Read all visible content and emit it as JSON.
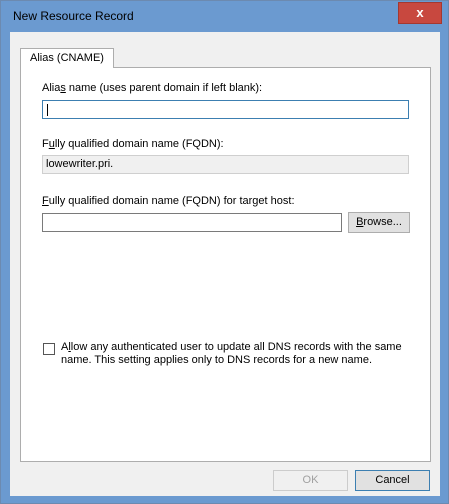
{
  "window": {
    "title": "New Resource Record",
    "close_glyph": "x"
  },
  "tabs": [
    {
      "label": "Alias (CNAME)",
      "selected": true
    }
  ],
  "alias_name": {
    "label_pre": "Alia",
    "label_accel": "s",
    "label_post": " name (uses parent domain if left blank):",
    "value": ""
  },
  "fqdn": {
    "label_pre": "F",
    "label_accel": "u",
    "label_post": "lly qualified domain name (FQDN):",
    "value": "lowewriter.pri."
  },
  "target_host": {
    "label_pre": "",
    "label_accel": "F",
    "label_post": "ully qualified domain name (FQDN) for target host:",
    "value": ""
  },
  "browse_button": {
    "label_accel": "B",
    "label_post": "rowse..."
  },
  "allow_update": {
    "checked": false,
    "label_pre": "A",
    "label_accel": "l",
    "label_post": "low any authenticated user to update all DNS records with the same name. This setting applies only to DNS records for a new name."
  },
  "footer": {
    "ok_label": "OK",
    "ok_enabled": false,
    "cancel_label": "Cancel"
  },
  "colors": {
    "titlebar": "#6b9ad0",
    "close_button": "#c8483f",
    "dialog_bg": "#f0f0f0"
  }
}
